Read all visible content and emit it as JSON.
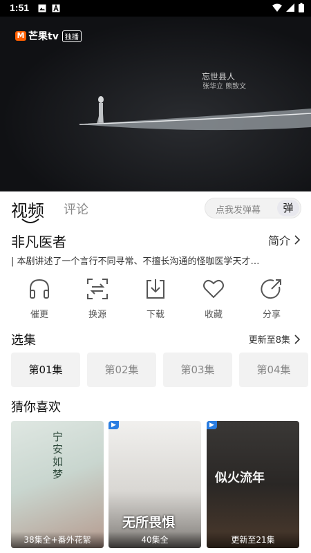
{
  "status_bar": {
    "time": "1:51"
  },
  "player": {
    "logo_text": "芒果tv",
    "logo_badge": "独播",
    "overlay_title": "忘世县人",
    "overlay_credit": "张华立  熊致文"
  },
  "tabs": {
    "video": "视频",
    "comment": "评论"
  },
  "danmaku": {
    "placeholder": "点我发弹幕",
    "button": "弹"
  },
  "show": {
    "title": "非凡医者",
    "intro_link": "简介",
    "synopsis": "| 本剧讲述了一个言行不同寻常、不擅长沟通的怪咖医学天才…"
  },
  "actions": [
    {
      "label": "催更",
      "icon": "headphones-icon"
    },
    {
      "label": "换源",
      "icon": "switch-source-icon"
    },
    {
      "label": "下载",
      "icon": "download-icon"
    },
    {
      "label": "收藏",
      "icon": "heart-icon"
    },
    {
      "label": "分享",
      "icon": "share-icon"
    }
  ],
  "episodes": {
    "heading": "选集",
    "update_text": "更新至8集",
    "items": [
      "第01集",
      "第02集",
      "第03集",
      "第04集"
    ],
    "selected": "第01集"
  },
  "recommendations": {
    "heading": "猜你喜欢",
    "items": [
      {
        "badge": "38集全+番外花絮",
        "poster_text": "宁安如梦"
      },
      {
        "badge": "40集全",
        "poster_text": "无所畏惧"
      },
      {
        "badge": "更新至21集",
        "poster_text": "似火流年"
      }
    ]
  },
  "colors": {
    "accent": "#ff5f00",
    "chip_bg": "#f2f2f2"
  }
}
